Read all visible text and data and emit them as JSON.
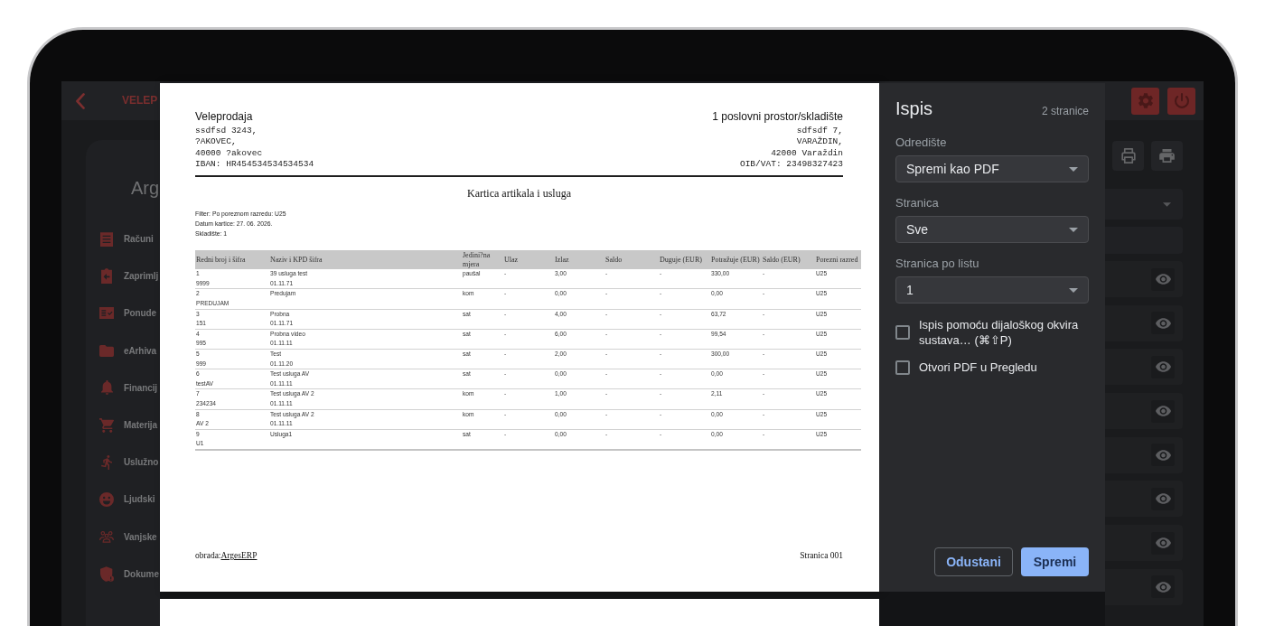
{
  "app": {
    "header": {
      "title": "VELEP"
    },
    "sidebar": {
      "title": "Arg",
      "items": [
        {
          "label": "Računi"
        },
        {
          "label": "Zaprimlj"
        },
        {
          "label": "Ponude"
        },
        {
          "label": "eArhiva"
        },
        {
          "label": "Financij"
        },
        {
          "label": "Materija"
        },
        {
          "label": "Uslužno"
        },
        {
          "label": "Ljudski"
        },
        {
          "label": "Vanjske"
        },
        {
          "label": "Dokume"
        }
      ]
    }
  },
  "document": {
    "sender": {
      "name": "Veleprodaja",
      "lines": [
        "ssdfsd 3243,",
        "?AKOVEC,",
        "40000 ?akovec",
        "IBAN: HR454534534534534"
      ]
    },
    "location": {
      "name": "1 poslovni prostor/skladište",
      "lines": [
        "sdfsdf 7,",
        "VARAŽDIN,",
        "42000 Varaždin",
        "OIB/VAT: 23498327423"
      ]
    },
    "title": "Kartica artikala i usluga",
    "filters": [
      "Filter: Po poreznom razredu: U25",
      "Datum kartice: 27. 06. 2026.",
      "Skladište: 1"
    ],
    "table": {
      "columns": [
        "Redni broj i šifra",
        "Naziv i KPD šifra",
        "Jedini?na mjera",
        "Ulaz",
        "Izlaz",
        "Saldo",
        "Duguje (EUR)",
        "Potražuje (EUR)",
        "Saldo (EUR)",
        "Porezni razred"
      ],
      "rows": [
        {
          "number": "1",
          "code": "9999",
          "name": "39 usluga test",
          "kpd": "01.11.71",
          "unit": "paušal",
          "in": "-",
          "out": "3,00",
          "balance": "-",
          "debit": "-",
          "credit": "330,00",
          "balance_eur": "-",
          "tax_class": "U25"
        },
        {
          "number": "2",
          "code": "PREDUJAM",
          "name": "Predujam",
          "unit": "kom",
          "in": "-",
          "out": "0,00",
          "balance": "-",
          "debit": "-",
          "credit": "0,00",
          "balance_eur": "-",
          "tax_class": "U25"
        },
        {
          "number": "3",
          "code": "151",
          "name": "Probna",
          "kpd": "01.11.71",
          "unit": "sat",
          "in": "-",
          "out": "4,00",
          "balance": "-",
          "debit": "-",
          "credit": "63,72",
          "balance_eur": "-",
          "tax_class": "U25"
        },
        {
          "number": "4",
          "code": "995",
          "name": "Probna video",
          "kpd": "01.11.11",
          "unit": "sat",
          "in": "-",
          "out": "6,00",
          "balance": "-",
          "debit": "-",
          "credit": "99,54",
          "balance_eur": "-",
          "tax_class": "U25"
        },
        {
          "number": "5",
          "code": "999",
          "name": "Test",
          "kpd": "01.11.20",
          "unit": "sat",
          "in": "-",
          "out": "2,00",
          "balance": "-",
          "debit": "-",
          "credit": "300,00",
          "balance_eur": "-",
          "tax_class": "U25"
        },
        {
          "number": "6",
          "code": "testAV",
          "name": "Test usluga AV",
          "kpd": "01.11.11",
          "unit": "sat",
          "in": "-",
          "out": "0,00",
          "balance": "-",
          "debit": "-",
          "credit": "0,00",
          "balance_eur": "-",
          "tax_class": "U25"
        },
        {
          "number": "7",
          "code": "234234",
          "name": "Test usluga AV 2",
          "kpd": "01.11.11",
          "unit": "kom",
          "in": "-",
          "out": "1,00",
          "balance": "-",
          "debit": "-",
          "credit": "2,11",
          "balance_eur": "-",
          "tax_class": "U25"
        },
        {
          "number": "8",
          "code": "AV 2",
          "name": "Test usluga AV 2",
          "kpd": "01.11.11",
          "unit": "kom",
          "in": "-",
          "out": "0,00",
          "balance": "-",
          "debit": "-",
          "credit": "0,00",
          "balance_eur": "-",
          "tax_class": "U25"
        },
        {
          "number": "9",
          "code": "U1",
          "name": "Usluga1",
          "unit": "sat",
          "in": "-",
          "out": "0,00",
          "balance": "-",
          "debit": "-",
          "credit": "0,00",
          "balance_eur": "-",
          "tax_class": "U25"
        }
      ]
    },
    "footer": {
      "label": "obrada:",
      "link": "ArgesERP",
      "page_label": "Stranica 001"
    }
  },
  "print_dialog": {
    "title": "Ispis",
    "page_count": "2 stranice",
    "selects": [
      {
        "label": "Odredište",
        "value": "Spremi kao PDF"
      },
      {
        "label": "Stranica",
        "value": "Sve"
      },
      {
        "label": "Stranica po listu",
        "value": "1"
      }
    ],
    "options": [
      {
        "label": "Ispis pomoću dijaloškog okvira sustava… (⌘⇧P)",
        "checked": false
      },
      {
        "label": "Otvori PDF u Pregledu",
        "checked": false
      }
    ],
    "buttons": [
      {
        "label": "Odustani",
        "kind": "secondary"
      },
      {
        "label": "Spremi",
        "kind": "primary"
      }
    ]
  }
}
